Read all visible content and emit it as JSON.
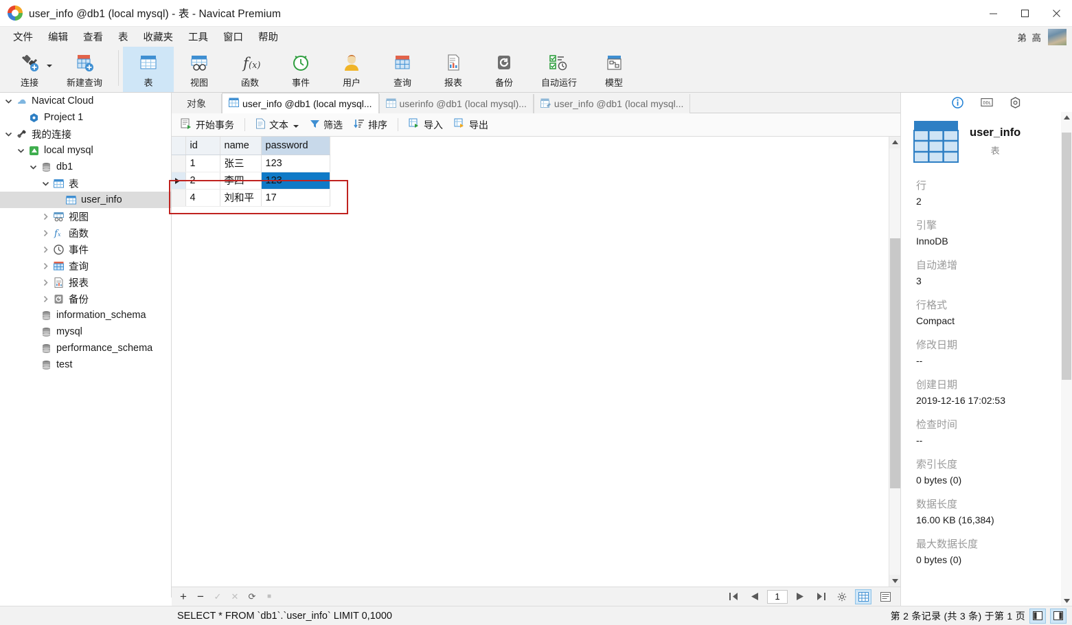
{
  "window": {
    "title": "user_info @db1 (local mysql) - 表 - Navicat Premium",
    "minimize_label": "最小化",
    "maximize_label": "最大化",
    "close_label": "关闭"
  },
  "menubar": {
    "items": [
      "文件",
      "编辑",
      "查看",
      "表",
      "收藏夹",
      "工具",
      "窗口",
      "帮助"
    ],
    "user_name": "弟 高"
  },
  "ribbon": {
    "buttons": [
      {
        "label": "连接",
        "icon": "connection-icon",
        "has_caret": true
      },
      {
        "label": "新建查询",
        "icon": "new-query-icon",
        "has_caret": false
      },
      {
        "label": "表",
        "icon": "table-icon",
        "selected": true
      },
      {
        "label": "视图",
        "icon": "view-icon",
        "selected": false
      },
      {
        "label": "函数",
        "icon": "function-icon",
        "selected": false
      },
      {
        "label": "事件",
        "icon": "event-icon",
        "selected": false
      },
      {
        "label": "用户",
        "icon": "user-icon",
        "selected": false
      },
      {
        "label": "查询",
        "icon": "query-icon",
        "selected": false
      },
      {
        "label": "报表",
        "icon": "report-icon",
        "selected": false
      },
      {
        "label": "备份",
        "icon": "backup-icon",
        "selected": false
      },
      {
        "label": "自动运行",
        "icon": "automation-icon",
        "selected": false
      },
      {
        "label": "模型",
        "icon": "model-icon",
        "selected": false
      }
    ]
  },
  "tree": {
    "nodes": [
      {
        "label": "Navicat Cloud",
        "indent": 0,
        "twisty": "down",
        "icon": "cloud-icon",
        "selected": false
      },
      {
        "label": "Project 1",
        "indent": 1,
        "twisty": "none",
        "icon": "project-icon",
        "selected": false
      },
      {
        "label": "我的连接",
        "indent": 0,
        "twisty": "down",
        "icon": "connection-icon",
        "selected": false
      },
      {
        "label": "local mysql",
        "indent": 1,
        "twisty": "down",
        "icon": "mysql-icon",
        "selected": false
      },
      {
        "label": "db1",
        "indent": 2,
        "twisty": "down",
        "icon": "database-icon",
        "selected": false
      },
      {
        "label": "表",
        "indent": 3,
        "twisty": "down",
        "icon": "table-icon",
        "selected": false
      },
      {
        "label": "user_info",
        "indent": 4,
        "twisty": "none",
        "icon": "table-icon",
        "selected": true
      },
      {
        "label": "视图",
        "indent": 3,
        "twisty": "right",
        "icon": "view-icon",
        "selected": false
      },
      {
        "label": "函数",
        "indent": 3,
        "twisty": "right",
        "icon": "function-icon",
        "selected": false
      },
      {
        "label": "事件",
        "indent": 3,
        "twisty": "right",
        "icon": "event-icon",
        "selected": false
      },
      {
        "label": "查询",
        "indent": 3,
        "twisty": "right",
        "icon": "query-icon",
        "selected": false
      },
      {
        "label": "报表",
        "indent": 3,
        "twisty": "right",
        "icon": "report-icon",
        "selected": false
      },
      {
        "label": "备份",
        "indent": 3,
        "twisty": "right",
        "icon": "backup-icon",
        "selected": false
      },
      {
        "label": "information_schema",
        "indent": 2,
        "twisty": "none",
        "icon": "database-icon",
        "selected": false
      },
      {
        "label": "mysql",
        "indent": 2,
        "twisty": "none",
        "icon": "database-icon",
        "selected": false
      },
      {
        "label": "performance_schema",
        "indent": 2,
        "twisty": "none",
        "icon": "database-icon",
        "selected": false
      },
      {
        "label": "test",
        "indent": 2,
        "twisty": "none",
        "icon": "database-icon",
        "selected": false
      }
    ]
  },
  "tabs": [
    {
      "label": "对象",
      "icon": "none",
      "active": false
    },
    {
      "label": "user_info @db1 (local mysql...",
      "icon": "table-icon",
      "active": true
    },
    {
      "label": "userinfo @db1 (local mysql)...",
      "icon": "table-icon",
      "active": false
    },
    {
      "label": "user_info @db1 (local mysql...",
      "icon": "table-design-icon",
      "active": false
    }
  ],
  "gridbar": {
    "buttons": [
      {
        "label": "开始事务",
        "icon": "transaction-icon"
      },
      {
        "label": "文本",
        "icon": "text-icon",
        "has_caret": true
      },
      {
        "label": "筛选",
        "icon": "filter-icon"
      },
      {
        "label": "排序",
        "icon": "sort-icon"
      },
      {
        "label": "导入",
        "icon": "import-icon"
      },
      {
        "label": "导出",
        "icon": "export-icon"
      }
    ]
  },
  "grid": {
    "columns": [
      "id",
      "name",
      "password"
    ],
    "selected_column": "password",
    "rows": [
      {
        "id": "1",
        "name": "张三",
        "password": "123",
        "current": false,
        "selected_cell": null
      },
      {
        "id": "2",
        "name": "李四",
        "password": "123",
        "current": true,
        "selected_cell": "password"
      },
      {
        "id": "4",
        "name": "刘和平",
        "password": "17",
        "current": false,
        "selected_cell": null
      }
    ]
  },
  "gridnav": {
    "add_label": "+",
    "remove_label": "−",
    "confirm_label": "✓",
    "cancel_label": "✕",
    "refresh_label": "⟳",
    "stop_label": "■",
    "first_label": "first-page",
    "prev_label": "previous-page",
    "page_value": "1",
    "next_label": "next-page",
    "last_label": "last-page",
    "settings_label": "settings",
    "view_grid_label": "grid-view",
    "view_form_label": "form-view"
  },
  "statusbar": {
    "sql": "SELECT * FROM `db1`.`user_info` LIMIT 0,1000",
    "record_info": "第 2 条记录 (共 3 条) 于第 1 页"
  },
  "infopanel": {
    "tabs": [
      {
        "name": "info-icon",
        "active": true
      },
      {
        "name": "ddl-icon",
        "active": false
      },
      {
        "name": "preference-icon",
        "active": false
      }
    ],
    "object_name": "user_info",
    "object_type": "表",
    "properties": [
      {
        "label": "行",
        "value": "2"
      },
      {
        "label": "引擎",
        "value": "InnoDB"
      },
      {
        "label": "自动递增",
        "value": "3"
      },
      {
        "label": "行格式",
        "value": "Compact"
      },
      {
        "label": "修改日期",
        "value": "--"
      },
      {
        "label": "创建日期",
        "value": "2019-12-16 17:02:53"
      },
      {
        "label": "检查时间",
        "value": "--"
      },
      {
        "label": "索引长度",
        "value": "0 bytes (0)"
      },
      {
        "label": "数据长度",
        "value": "16.00 KB (16,384)"
      },
      {
        "label": "最大数据长度",
        "value": "0 bytes (0)"
      }
    ]
  },
  "colors": {
    "accent": "#0f7ac7",
    "annotation": "#c0221f",
    "ribbon_selected": "#cfe6f7"
  }
}
